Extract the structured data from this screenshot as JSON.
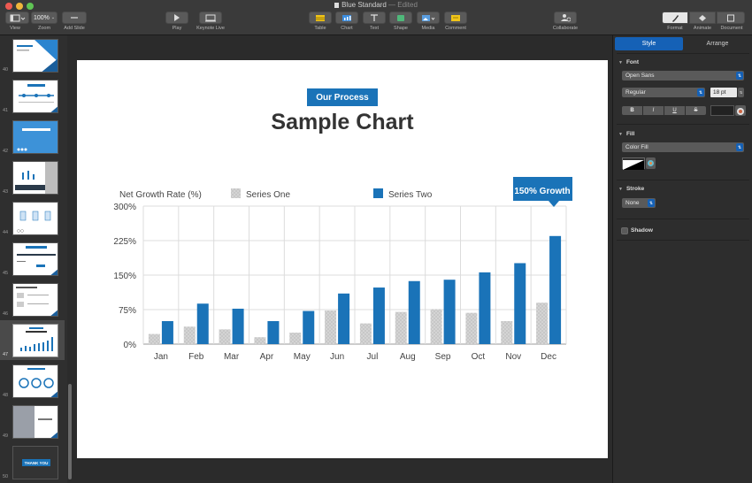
{
  "window": {
    "title": "Blue Standard",
    "status": "— Edited"
  },
  "toolbar": {
    "view_label": "View",
    "zoom_value": "100%",
    "zoom_label": "Zoom",
    "add_slide_label": "Add Slide",
    "play_label": "Play",
    "keynote_live_label": "Keynote Live",
    "table_label": "Table",
    "chart_label": "Chart",
    "text_label": "Text",
    "shape_label": "Shape",
    "media_label": "Media",
    "comment_label": "Comment",
    "collaborate_label": "Collaborate",
    "format_label": "Format",
    "animate_label": "Animate",
    "document_label": "Document"
  },
  "navigator": {
    "slides": [
      "40",
      "41",
      "42",
      "43",
      "44",
      "45",
      "46",
      "47",
      "48",
      "49",
      "50"
    ],
    "selected": "47",
    "last_thumb_text": "THANK YOU"
  },
  "slide": {
    "pill": "Our Process",
    "title": "Sample Chart",
    "callout": "150% Growth"
  },
  "chart_data": {
    "type": "bar",
    "ylabel": "Net Growth Rate (%)",
    "categories": [
      "Jan",
      "Feb",
      "Mar",
      "Apr",
      "May",
      "Jun",
      "Jul",
      "Aug",
      "Sep",
      "Oct",
      "Nov",
      "Dec"
    ],
    "series": [
      {
        "name": "Series One",
        "values": [
          22,
          38,
          32,
          15,
          25,
          73,
          45,
          70,
          76,
          68,
          50,
          90
        ],
        "color": "#cfcfcf"
      },
      {
        "name": "Series Two",
        "values": [
          50,
          88,
          77,
          50,
          72,
          110,
          123,
          137,
          140,
          156,
          176,
          235
        ],
        "color": "#1a73b8"
      }
    ],
    "yticks": [
      "300%",
      "225%",
      "150%",
      "75%",
      "0%"
    ],
    "ylim": [
      0,
      300
    ],
    "grid": true,
    "legend": "top"
  },
  "inspector": {
    "tabs": [
      "Style",
      "Arrange"
    ],
    "font": {
      "heading": "Font",
      "family": "Open Sans",
      "style": "Regular",
      "size": "18 pt",
      "buttons": [
        "B",
        "I",
        "U",
        "S"
      ]
    },
    "fill": {
      "heading": "Fill",
      "type": "Color Fill"
    },
    "stroke": {
      "heading": "Stroke",
      "type": "None"
    },
    "shadow": {
      "label": "Shadow"
    }
  },
  "colors": {
    "accent": "#1561b6",
    "brand_blue": "#1a73b8",
    "series_one": "#cfcfcf"
  }
}
